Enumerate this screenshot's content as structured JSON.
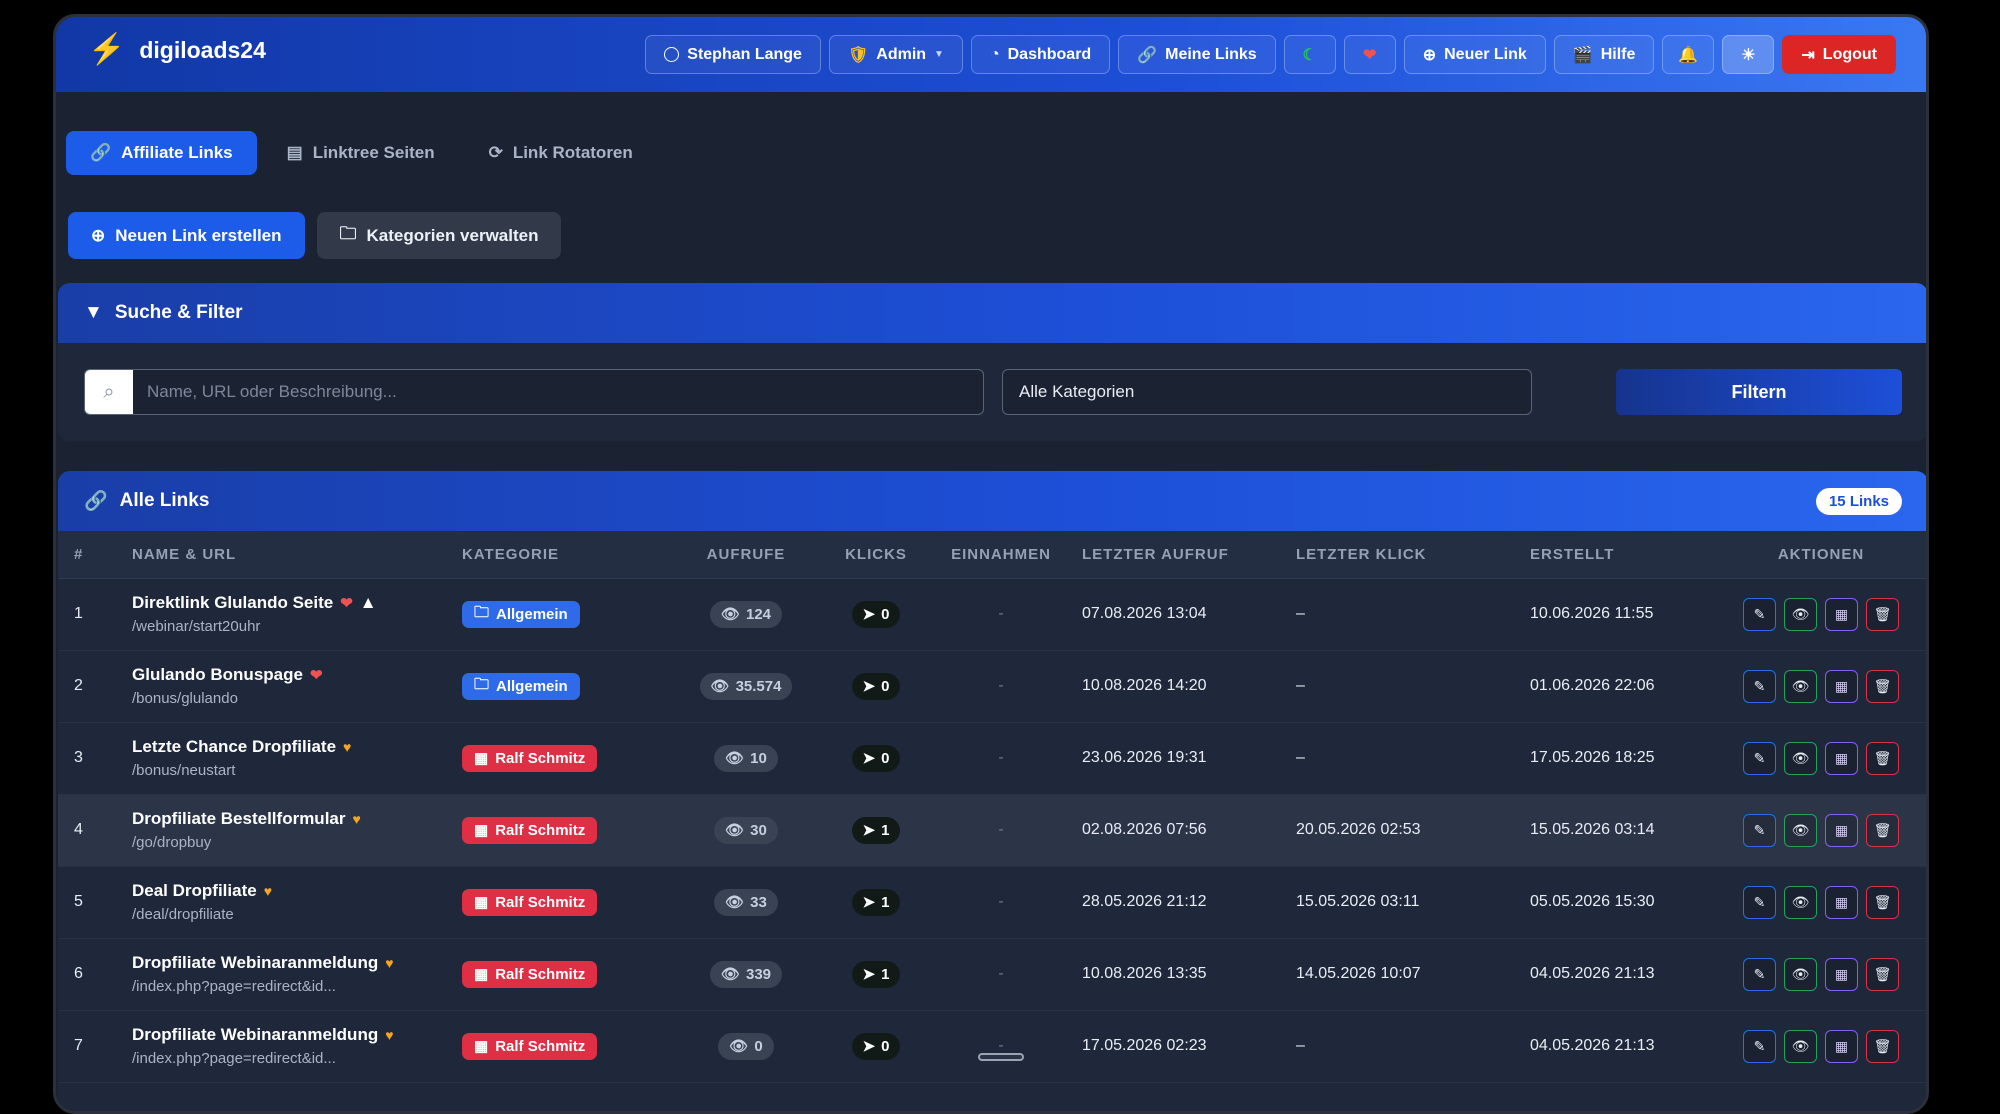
{
  "brand": {
    "name": "digiloads24",
    "icon": "lightning-icon"
  },
  "nav": {
    "user": "Stephan Lange",
    "admin": "Admin",
    "dashboard": "Dashboard",
    "my_links": "Meine Links",
    "new_link": "Neuer Link",
    "help": "Hilfe",
    "logout": "Logout"
  },
  "tabs": [
    {
      "label": "Affiliate Links",
      "active": true
    },
    {
      "label": "Linktree Seiten",
      "active": false
    },
    {
      "label": "Link Rotatoren",
      "active": false
    }
  ],
  "buttons": {
    "create": "Neuen Link erstellen",
    "categories": "Kategorien verwalten"
  },
  "filter": {
    "title": "Suche & Filter",
    "placeholder": "Name, URL oder Beschreibung...",
    "category_selected": "Alle Kategorien",
    "button": "Filtern"
  },
  "links": {
    "title": "Alle Links",
    "count": "15 Links",
    "columns": [
      "#",
      "NAME & URL",
      "KATEGORIE",
      "AUFRUFE",
      "KLICKS",
      "EINNAHMEN",
      "LETZTER AUFRUF",
      "LETZTER KLICK",
      "ERSTELLT",
      "AKTIONEN"
    ],
    "rows": [
      {
        "num": "1",
        "name": "Direktlink Glulando Seite",
        "url": "/webinar/start20uhr",
        "badges": [
          "heart",
          "warning"
        ],
        "category": "Allgemein",
        "cat_color": "blue",
        "views": "124",
        "clicks": "0",
        "income": "-",
        "last_view": "07.08.2026 13:04",
        "last_click": "–",
        "created": "10.06.2026 11:55"
      },
      {
        "num": "2",
        "name": "Glulando Bonuspage",
        "url": "/bonus/glulando",
        "badges": [
          "heart"
        ],
        "category": "Allgemein",
        "cat_color": "blue",
        "views": "35.574",
        "clicks": "0",
        "income": "-",
        "last_view": "10.08.2026 14:20",
        "last_click": "–",
        "created": "01.06.2026 22:06"
      },
      {
        "num": "3",
        "name": "Letzte Chance Dropfiliate",
        "url": "/bonus/neustart",
        "badges": [
          "star"
        ],
        "category": "Ralf Schmitz",
        "cat_color": "red",
        "views": "10",
        "clicks": "0",
        "income": "-",
        "last_view": "23.06.2026 19:31",
        "last_click": "–",
        "created": "17.05.2026 18:25"
      },
      {
        "num": "4",
        "name": "Dropfiliate Bestellformular",
        "url": "/go/dropbuy",
        "badges": [
          "star"
        ],
        "category": "Ralf Schmitz",
        "cat_color": "red",
        "views": "30",
        "clicks": "1",
        "income": "-",
        "last_view": "02.08.2026 07:56",
        "last_click": "20.05.2026 02:53",
        "created": "15.05.2026 03:14"
      },
      {
        "num": "5",
        "name": "Deal Dropfiliate",
        "url": "/deal/dropfiliate",
        "badges": [
          "star"
        ],
        "category": "Ralf Schmitz",
        "cat_color": "red",
        "views": "33",
        "clicks": "1",
        "income": "-",
        "last_view": "28.05.2026 21:12",
        "last_click": "15.05.2026 03:11",
        "created": "05.05.2026 15:30"
      },
      {
        "num": "6",
        "name": "Dropfiliate Webinaranmeldung",
        "url": "/index.php?page=redirect&id...",
        "badges": [
          "star"
        ],
        "category": "Ralf Schmitz",
        "cat_color": "red",
        "views": "339",
        "clicks": "1",
        "income": "-",
        "last_view": "10.08.2026 13:35",
        "last_click": "14.05.2026 10:07",
        "created": "04.05.2026 21:13"
      },
      {
        "num": "7",
        "name": "Dropfiliate Webinaranmeldung",
        "url": "/index.php?page=redirect&id...",
        "badges": [
          "star"
        ],
        "category": "Ralf Schmitz",
        "cat_color": "red",
        "views": "0",
        "clicks": "0",
        "income": "-",
        "last_view": "17.05.2026 02:23",
        "last_click": "–",
        "created": "04.05.2026 21:13"
      }
    ]
  }
}
